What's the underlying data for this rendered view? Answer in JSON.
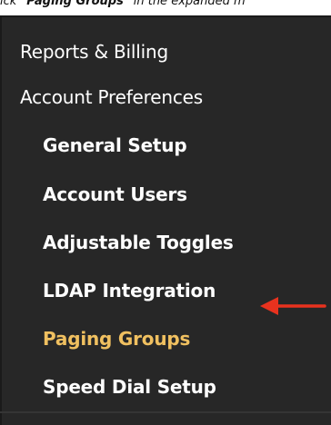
{
  "caption": {
    "prefix": "ick ",
    "bold": "\"Paging Groups\"",
    "suffix": " in the expanded m"
  },
  "menu": {
    "items": [
      {
        "label": "Reports & Billing",
        "level": "top"
      },
      {
        "label": "Account Preferences",
        "level": "top"
      }
    ],
    "subitems": [
      {
        "label": "General Setup"
      },
      {
        "label": "Account Users"
      },
      {
        "label": "Adjustable Toggles"
      },
      {
        "label": "LDAP Integration"
      },
      {
        "label": "Paging Groups",
        "active": true
      },
      {
        "label": "Speed Dial Setup"
      }
    ]
  },
  "colors": {
    "background": "#272727",
    "text": "#ffffff",
    "active_text": "#f0c060",
    "arrow": "#e8321e"
  },
  "annotation": {
    "icon": "arrow-left-icon"
  }
}
